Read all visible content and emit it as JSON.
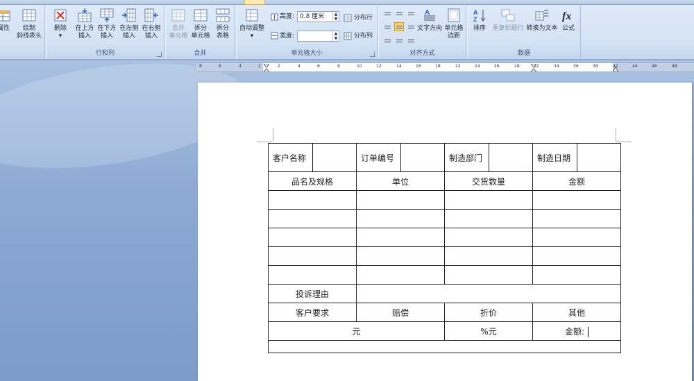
{
  "ribbon": {
    "groups": {
      "table": {
        "label": ""
      },
      "rows_cols": {
        "label": "行和列"
      },
      "merge": {
        "label": "合并"
      },
      "cell_size": {
        "label": "单元格大小"
      },
      "alignment": {
        "label": "对齐方式"
      },
      "data": {
        "label": "数据"
      }
    },
    "properties_label": "属性",
    "draw_diag": {
      "line1": "绘制",
      "line2": "斜线表头"
    },
    "delete": {
      "label": "删除",
      "arrow": "▾"
    },
    "insert_above": {
      "line1": "在上方",
      "line2": "插入"
    },
    "insert_below": {
      "line1": "在下方",
      "line2": "插入"
    },
    "insert_left": {
      "line1": "在左侧",
      "line2": "插入"
    },
    "insert_right": {
      "line1": "在右侧",
      "line2": "插入"
    },
    "merge_cells": {
      "line1": "合并",
      "line2": "单元格"
    },
    "split_cells": {
      "line1": "拆分",
      "line2": "单元格"
    },
    "split_table": {
      "line1": "拆分",
      "line2": "表格"
    },
    "autofit": {
      "label": "自动调整",
      "arrow": "▾"
    },
    "height": {
      "label": "高度:",
      "value": "0.8 厘米"
    },
    "width": {
      "label": "宽度:",
      "value": ""
    },
    "distribute_rows": "分布行",
    "distribute_cols": "分布列",
    "text_direction": "文字方向",
    "cell_margins": {
      "line1": "单元格",
      "line2": "边距"
    },
    "sort": "排序",
    "repeat_header": "重复标题行",
    "convert_text": "转换为文本",
    "formula": "公式"
  },
  "ruler": {
    "numbers": [
      "8",
      "6",
      "4",
      "2",
      "2",
      "4",
      "6",
      "8",
      "10",
      "12",
      "14",
      "16",
      "18",
      "22",
      "24",
      "26",
      "28",
      "32",
      "34",
      "36",
      "38",
      "42",
      "44",
      "46",
      "48"
    ]
  },
  "table": {
    "row1": [
      "客户名称",
      "",
      "订单编号",
      "",
      "制造部门",
      "",
      "制造日期",
      ""
    ],
    "row2": [
      "品名及规格",
      "单位",
      "交货数量",
      "金额"
    ],
    "complaint_label": "投诉理由",
    "complaint_value": "",
    "demand_row": [
      "客户要求",
      "赔偿",
      "折价",
      "其他"
    ],
    "amount_row": [
      "元",
      "%元",
      "金额:"
    ]
  }
}
